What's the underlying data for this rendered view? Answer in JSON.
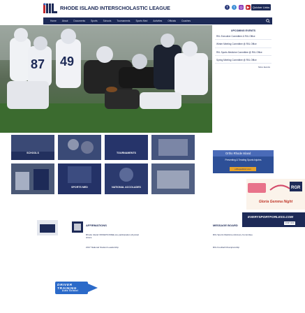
{
  "header": {
    "logo_letters": "RIIL",
    "site_name": "RHODE ISLAND INTERSCHOLASTIC LEAGUE",
    "top_button": "Quicker Links",
    "social_icons": [
      "facebook-icon",
      "twitter-icon",
      "instagram-icon",
      "youtube-icon",
      "email-icon"
    ]
  },
  "nav": {
    "items": [
      "Home",
      "About",
      "Documents",
      "Sports",
      "Schools",
      "Tournaments",
      "Sports Med",
      "Activities",
      "Officials",
      "Coaches"
    ]
  },
  "events": {
    "heading": "UPCOMING EVENTS",
    "items": [
      {
        "title": "RIIL Executive Committee & RIIL Office",
        "date": ""
      },
      {
        "title": "Winter Meeting Committee @ RIIL Office",
        "date": ""
      },
      {
        "title": "RIIL Sports Medicine Committee @ RIIL Office",
        "date": ""
      },
      {
        "title": "Spring Meeting Committee @ RIIL Office",
        "date": ""
      }
    ],
    "more_label": "More Events"
  },
  "ortho_ad": {
    "bar": "Ortho Rhode Island",
    "sub": "Preventing & Treating Sports Injuries",
    "button": "orthopedicsri.com"
  },
  "tiles_row1": [
    {
      "label": "SCHOOLS"
    },
    {
      "label": ""
    },
    {
      "label": "TOURNAMENTS"
    },
    {
      "label": ""
    }
  ],
  "tiles_row2": [
    {
      "label": ""
    },
    {
      "label": "SPORTS MED"
    },
    {
      "label": "NATIONAL ACCOLADES"
    },
    {
      "label": ""
    }
  ],
  "gloria_ad": {
    "title": "Gloria Gemma Night",
    "badge": "RGR"
  },
  "everysport_ad": {
    "title": "EVERYSPORTFORLESS.COM",
    "button": "SHOP NOW"
  },
  "bottom": {
    "news_heading": "AFFIRMATIONS",
    "news_items": [
      {
        "title": "Rhode Island OFFERS FREE pre-participation physical clinics",
        "date": ""
      },
      {
        "title": "2017 National Student Leadership",
        "date": ""
      }
    ],
    "message_heading": "MESSAGE BOARD",
    "message_items": [
      {
        "title": "RIIL Sports Medicine Advisory Committee",
        "date": ""
      },
      {
        "title": "RIIL Football Championship",
        "date": ""
      }
    ]
  },
  "driver_ad": {
    "line1": "DRIVER TRAINING",
    "line2": "Auto School"
  },
  "colors": {
    "navy": "#1d2a57",
    "blue": "#2b6ac9",
    "gold": "#e6a22a"
  }
}
